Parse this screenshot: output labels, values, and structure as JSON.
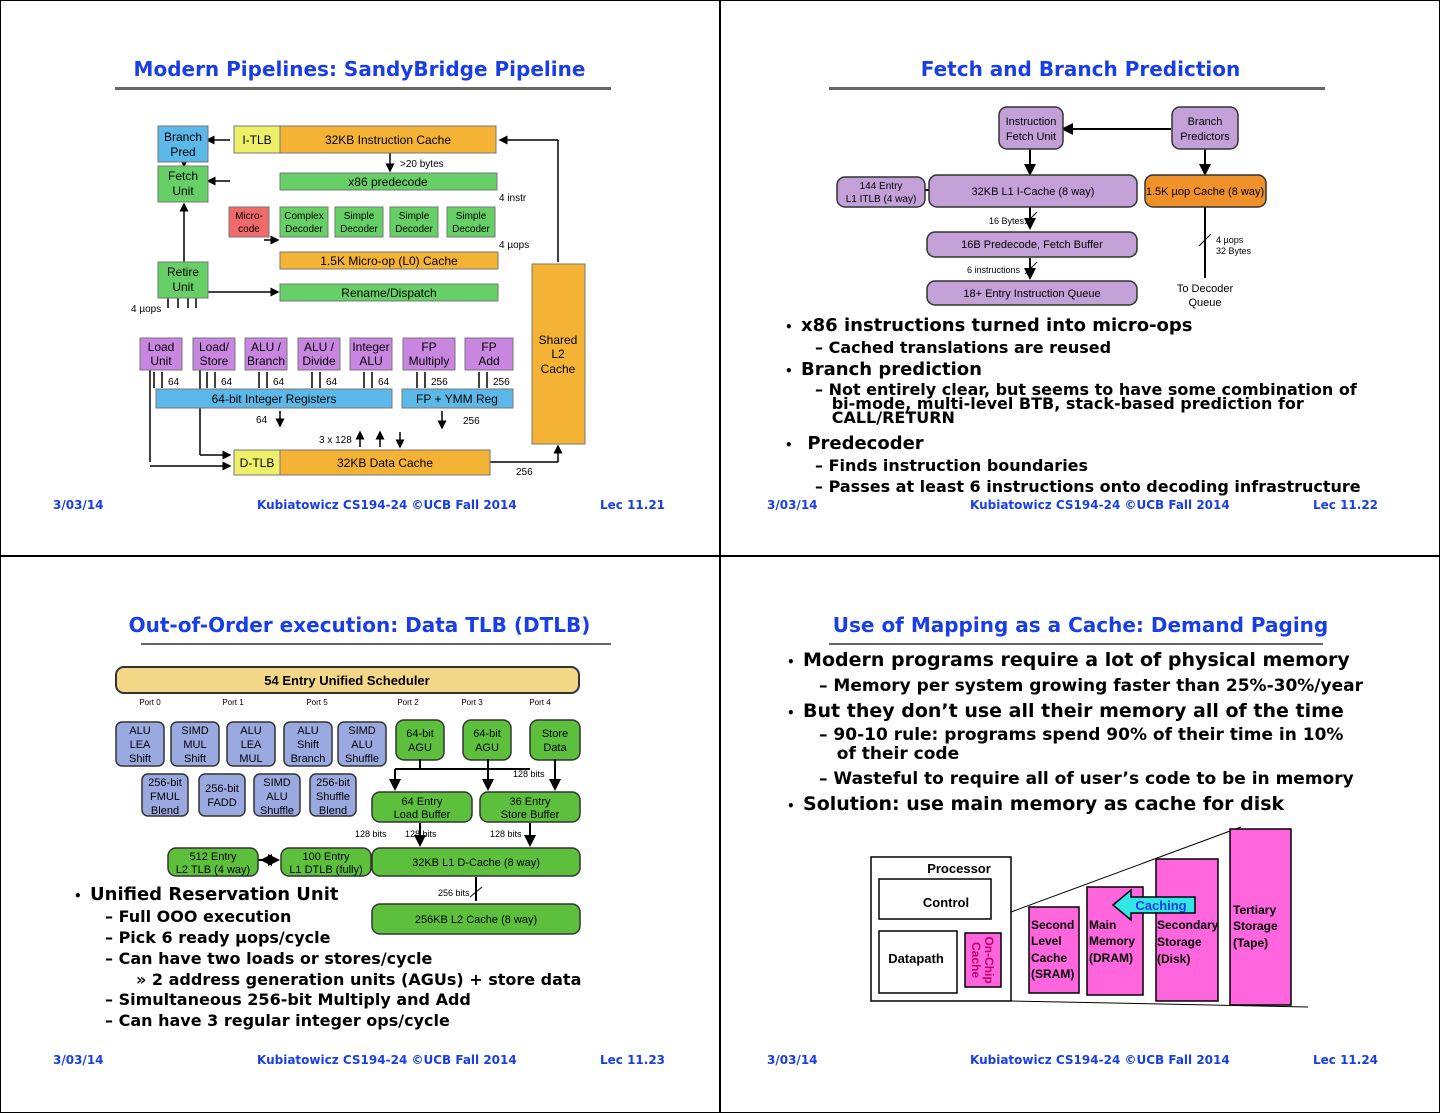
{
  "slides": [
    {
      "title": "Modern Pipelines: SandyBridge Pipeline",
      "footer": {
        "date": "3/03/14",
        "center": "Kubiatowicz CS194-24 ©UCB Fall 2014",
        "lec": "Lec 11.21"
      },
      "diagram": {
        "branch_pred": [
          "Branch",
          "Pred"
        ],
        "itlb": "I-TLB",
        "icache": "32KB Instruction Cache",
        "bytes20": ">20 bytes",
        "fetch_unit": [
          "Fetch",
          "Unit"
        ],
        "predecode": "x86 predecode",
        "instr4": "4 instr",
        "microcode": [
          "Micro-",
          "code"
        ],
        "decoders": [
          [
            "Complex",
            "Decoder"
          ],
          [
            "Simple",
            "Decoder"
          ],
          [
            "Simple",
            "Decoder"
          ],
          [
            "Simple",
            "Decoder"
          ]
        ],
        "uops4": "4 µops",
        "uop_cache": "1.5K Micro-op (L0) Cache",
        "retire": [
          "Retire",
          "Unit"
        ],
        "rename": "Rename/Dispatch",
        "uops4_left": "4 µops",
        "units": [
          [
            "Load",
            "Unit"
          ],
          [
            "Load/",
            "Store"
          ],
          [
            "ALU /",
            "Branch"
          ],
          [
            "ALU /",
            "Divide"
          ],
          [
            "Integer",
            "ALU"
          ],
          [
            "FP",
            "Multiply"
          ],
          [
            "FP",
            "Add"
          ]
        ],
        "shared_l2": [
          "Shared",
          "L2",
          "Cache"
        ],
        "bus_labels": [
          "64",
          "64",
          "64",
          "64",
          "64",
          "256",
          "256"
        ],
        "int_regs": "64-bit Integer Registers",
        "fp_regs": "FP + YMM Reg",
        "reg64": "64",
        "reg256": "256",
        "x3_128": "3 x 128",
        "dtlb": "D-TLB",
        "dcache": "32KB Data Cache",
        "l2_256": "256"
      }
    },
    {
      "title": "Fetch and Branch Prediction",
      "footer": {
        "date": "3/03/14",
        "center": "Kubiatowicz CS194-24 ©UCB Fall 2014",
        "lec": "Lec 11.22"
      },
      "diagram": {
        "ifu": [
          "Instruction",
          "Fetch Unit"
        ],
        "bp": [
          "Branch",
          "Predictors"
        ],
        "itlb": [
          "144 Entry",
          "L1 ITLB (4 way)"
        ],
        "l1i": "32KB L1 I-Cache (8 way)",
        "uopc": "1.5K µop Cache (8 way)",
        "b16": "16 Bytes",
        "predecode": "16B Predecode, Fetch Buffer",
        "uops4": "4 µops",
        "bytes32": "32 Bytes",
        "instr6": "6 instructions",
        "iq": "18+ Entry Instruction Queue",
        "todec": [
          "To Decoder",
          "Queue"
        ]
      },
      "bullets": {
        "b1": "x86 instructions turned into micro-ops",
        "b1a": "Cached translations are reused",
        "b2": "Branch prediction",
        "b2a_1": "Not entirely clear, but seems to have some combination of",
        "b2a_2": "bi-mode, multi-level BTB, stack-based prediction for",
        "b2a_3": "CALL/RETURN",
        "b3": "Predecoder",
        "b3a": "Finds instruction boundaries",
        "b3b": "Passes at least 6 instructions onto decoding infrastructure"
      }
    },
    {
      "title": "Out-of-Order execution: Data TLB (DTLB)",
      "footer": {
        "date": "3/03/14",
        "center": "Kubiatowicz CS194-24 ©UCB Fall 2014",
        "lec": "Lec 11.23"
      },
      "diagram": {
        "sched": "54 Entry Unified Scheduler",
        "ports": [
          "Port 0",
          "Port 1",
          "Port 5",
          "Port 2",
          "Port 3",
          "Port 4"
        ],
        "row1": [
          [
            "ALU",
            "LEA",
            "Shift"
          ],
          [
            "SIMD",
            "MUL",
            "Shift"
          ],
          [
            "ALU",
            "LEA",
            "MUL"
          ],
          [
            "ALU",
            "Shift",
            "Branch"
          ],
          [
            "SIMD",
            "ALU",
            "Shuffle"
          ]
        ],
        "agu": [
          [
            "64-bit",
            "AGU"
          ],
          [
            "64-bit",
            "AGU"
          ]
        ],
        "store_data": [
          "Store",
          "Data"
        ],
        "row2": [
          [
            "256-bit",
            "FMUL",
            "Blend"
          ],
          [
            "256-bit",
            "FADD"
          ],
          [
            "SIMD",
            "ALU",
            "Shuffle"
          ],
          [
            "256-bit",
            "Shuffle",
            "Blend"
          ]
        ],
        "lbuf": [
          "64 Entry",
          "Load Buffer"
        ],
        "sbuf": [
          "36 Entry",
          "Store Buffer"
        ],
        "bits128": [
          "128 bits",
          "128 bits",
          "128 bits",
          "128 bits"
        ],
        "l2tlb": [
          "512 Entry",
          "L2 TLB (4 way)"
        ],
        "l1dtlb": [
          "100 Entry",
          "L1 DTLB (fully)"
        ],
        "l1d": "32KB L1 D-Cache (8 way)",
        "bits256": "256 bits",
        "l2": "256KB L2 Cache (8 way)"
      },
      "bullets": {
        "b1": "Unified Reservation Unit",
        "b1a": "Full OOO execution",
        "b1b": "Pick 6 ready µops/cycle",
        "b1c": "Can have two loads or stores/cycle",
        "b1c_i": "2 address generation units (AGUs) + store data",
        "b1d": "Simultaneous 256-bit Multiply and Add",
        "b1e": "Can have 3 regular integer ops/cycle"
      }
    },
    {
      "title": "Use of Mapping as a Cache: Demand Paging",
      "footer": {
        "date": "3/03/14",
        "center": "Kubiatowicz CS194-24 ©UCB Fall 2014",
        "lec": "Lec 11.24"
      },
      "bullets": {
        "b1": "Modern programs require a lot of physical memory",
        "b1a": "Memory per system growing faster than 25%-30%/year",
        "b2": "But they don’t use all their memory all of the time",
        "b2a_1": "90-10 rule: programs spend 90% of their time in 10%",
        "b2a_2": "of their code",
        "b2b": "Wasteful to require all of user’s code to be in memory",
        "b3": "Solution: use main memory as cache for disk"
      },
      "diagram": {
        "processor": "Processor",
        "control": "Control",
        "datapath": "Datapath",
        "onchip": [
          "On-Chip",
          "Cache"
        ],
        "l2": [
          "Second",
          "Level",
          "Cache",
          "(SRAM)"
        ],
        "main": [
          "Main",
          "Memory",
          "(DRAM)"
        ],
        "secondary": [
          "Secondary",
          "Storage",
          "(Disk)"
        ],
        "tertiary": [
          "Tertiary",
          "Storage",
          "(Tape)"
        ],
        "caching": "Caching"
      }
    }
  ],
  "colors": {
    "title": "#1a3ee6",
    "orange": "#f5b335",
    "green": "#66d066",
    "purple": "#c986e0",
    "blue": "#5cb8e8",
    "magenta": "#ff66dd"
  }
}
